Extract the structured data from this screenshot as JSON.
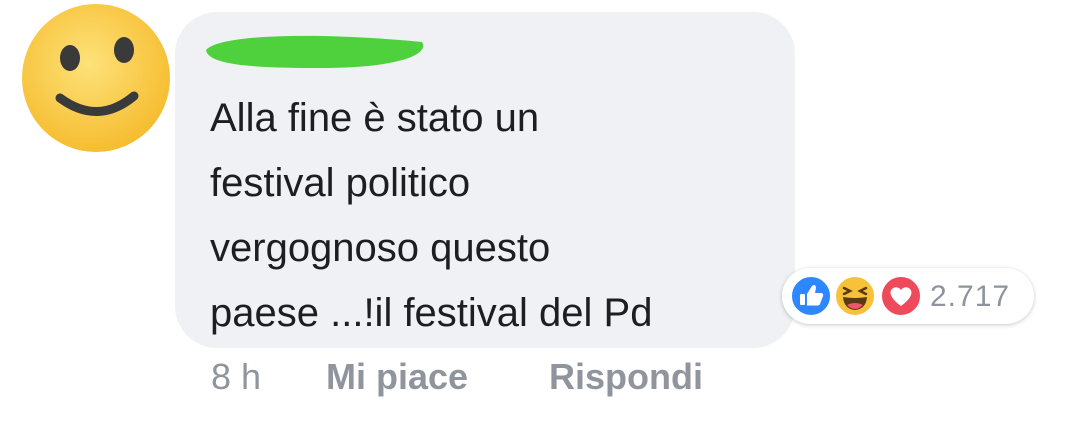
{
  "comment": {
    "author_redacted": true,
    "text_lines": [
      "Alla fine è stato un",
      "festival politico",
      "vergognoso questo",
      "paese ...!il festival del Pd"
    ]
  },
  "reactions": {
    "icons": [
      "like-icon",
      "haha-icon",
      "love-icon"
    ],
    "count": "2.717"
  },
  "actions": {
    "time": "8 h",
    "like_label": "Mi piace",
    "reply_label": "Rispondi"
  },
  "colors": {
    "bubble": "#f0f1f4",
    "text": "#1c1e21",
    "muted": "#90949c",
    "like": "#2d88ff",
    "love": "#ee4a5b",
    "haha": "#f7c23a",
    "redaction": "#4fd13d",
    "avatar": "#f9c642"
  }
}
